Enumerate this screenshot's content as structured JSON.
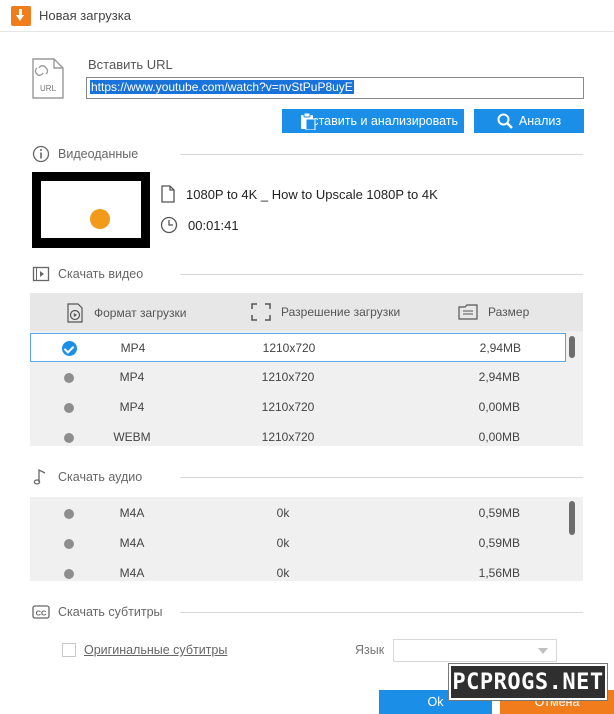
{
  "window": {
    "title": "Новая загрузка"
  },
  "url_section": {
    "icon_text": "URL",
    "label": "Вставить URL",
    "value": "https://www.youtube.com/watch?v=nvStPuP8uyE",
    "paste_button": "Вставить и анализировать",
    "analyze_button": "Анализ"
  },
  "video_data": {
    "section_title": "Видеоданные",
    "title": "1080P to 4K _ How to Upscale 1080P to 4K",
    "duration": "00:01:41"
  },
  "download_video": {
    "section_title": "Скачать видео",
    "columns": [
      "Формат загрузки",
      "Разрешение загрузки",
      "Размер"
    ],
    "rows": [
      {
        "format": "MP4",
        "resolution": "1210x720",
        "size": "2,94MB",
        "selected": true
      },
      {
        "format": "MP4",
        "resolution": "1210x720",
        "size": "2,94MB",
        "selected": false
      },
      {
        "format": "MP4",
        "resolution": "1210x720",
        "size": "0,00MB",
        "selected": false
      },
      {
        "format": "WEBM",
        "resolution": "1210x720",
        "size": "0,00MB",
        "selected": false
      }
    ]
  },
  "download_audio": {
    "section_title": "Скачать аудио",
    "rows": [
      {
        "format": "M4A",
        "bitrate": "0k",
        "size": "0,59MB"
      },
      {
        "format": "M4A",
        "bitrate": "0k",
        "size": "0,59MB"
      },
      {
        "format": "M4A",
        "bitrate": "0k",
        "size": "1,56MB"
      }
    ]
  },
  "subtitles": {
    "section_title": "Скачать субтитры",
    "original_label": "Оригинальные субтитры",
    "language_label": "Язык",
    "language_value": ""
  },
  "footer": {
    "ok": "Ok",
    "cancel": "Отмена"
  },
  "watermark": {
    "text": "PCPROGS.NET"
  },
  "colors": {
    "accent_blue": "#1b8fe8",
    "accent_orange": "#f07c1c"
  }
}
